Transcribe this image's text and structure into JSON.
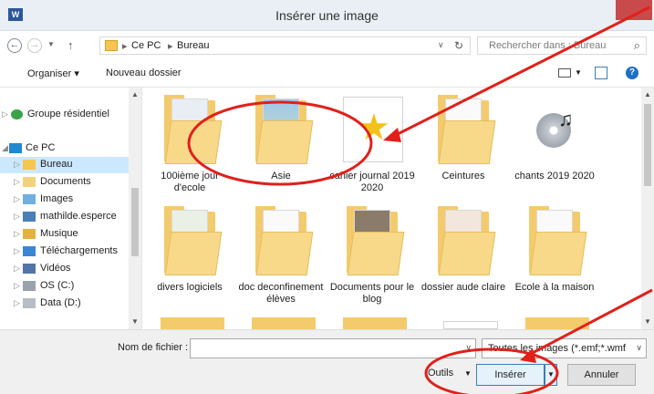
{
  "window": {
    "app_icon_text": "W",
    "title": "Insérer une image"
  },
  "address": {
    "back_symbol": "←",
    "forward_symbol": "→",
    "up_symbol": "↑",
    "breadcrumbs": [
      "Ce PC",
      "Bureau"
    ],
    "refresh_symbol": "↻",
    "search_placeholder": "Rechercher dans : Bureau",
    "search_symbol": "⌕"
  },
  "toolbar": {
    "organize_label": "Organiser ▾",
    "new_folder_label": "Nouveau dossier",
    "help_symbol": "?"
  },
  "sidebar": {
    "items": [
      {
        "label": "Groupe résidentiel",
        "indent": 0
      },
      {
        "label": "Ce PC",
        "indent": 0
      },
      {
        "label": "Bureau",
        "indent": 1,
        "selected": true
      },
      {
        "label": "Documents",
        "indent": 1
      },
      {
        "label": "Images",
        "indent": 1
      },
      {
        "label": "mathilde.esperce",
        "indent": 1
      },
      {
        "label": "Musique",
        "indent": 1
      },
      {
        "label": "Téléchargements",
        "indent": 1
      },
      {
        "label": "Vidéos",
        "indent": 1
      },
      {
        "label": "OS (C:)",
        "indent": 1
      },
      {
        "label": "Data (D:)",
        "indent": 1
      }
    ]
  },
  "files": [
    {
      "caption": "100ième jour d'ecole",
      "kind": "folder"
    },
    {
      "caption": "Asie",
      "kind": "folder"
    },
    {
      "caption": "cahier journal 2019 2020",
      "kind": "star"
    },
    {
      "caption": "Ceintures",
      "kind": "folder"
    },
    {
      "caption": "chants 2019 2020",
      "kind": "cd"
    },
    {
      "caption": "divers logiciels",
      "kind": "folder"
    },
    {
      "caption": "doc deconfinement élèves",
      "kind": "folder"
    },
    {
      "caption": "Documents pour le blog",
      "kind": "folder"
    },
    {
      "caption": "dossier aude claire",
      "kind": "folder"
    },
    {
      "caption": "Ecole à la maison",
      "kind": "folder"
    }
  ],
  "bottom": {
    "filename_label": "Nom de fichier :",
    "filename_value": "",
    "filetype_value": "Toutes les images (*.emf;*.wmf",
    "tools_label": "Outils",
    "insert_label": "Insérer",
    "cancel_label": "Annuler"
  },
  "colors": {
    "accent": "#3c7fb1",
    "selection": "#cce8ff",
    "annotation_red": "#e0201b"
  }
}
